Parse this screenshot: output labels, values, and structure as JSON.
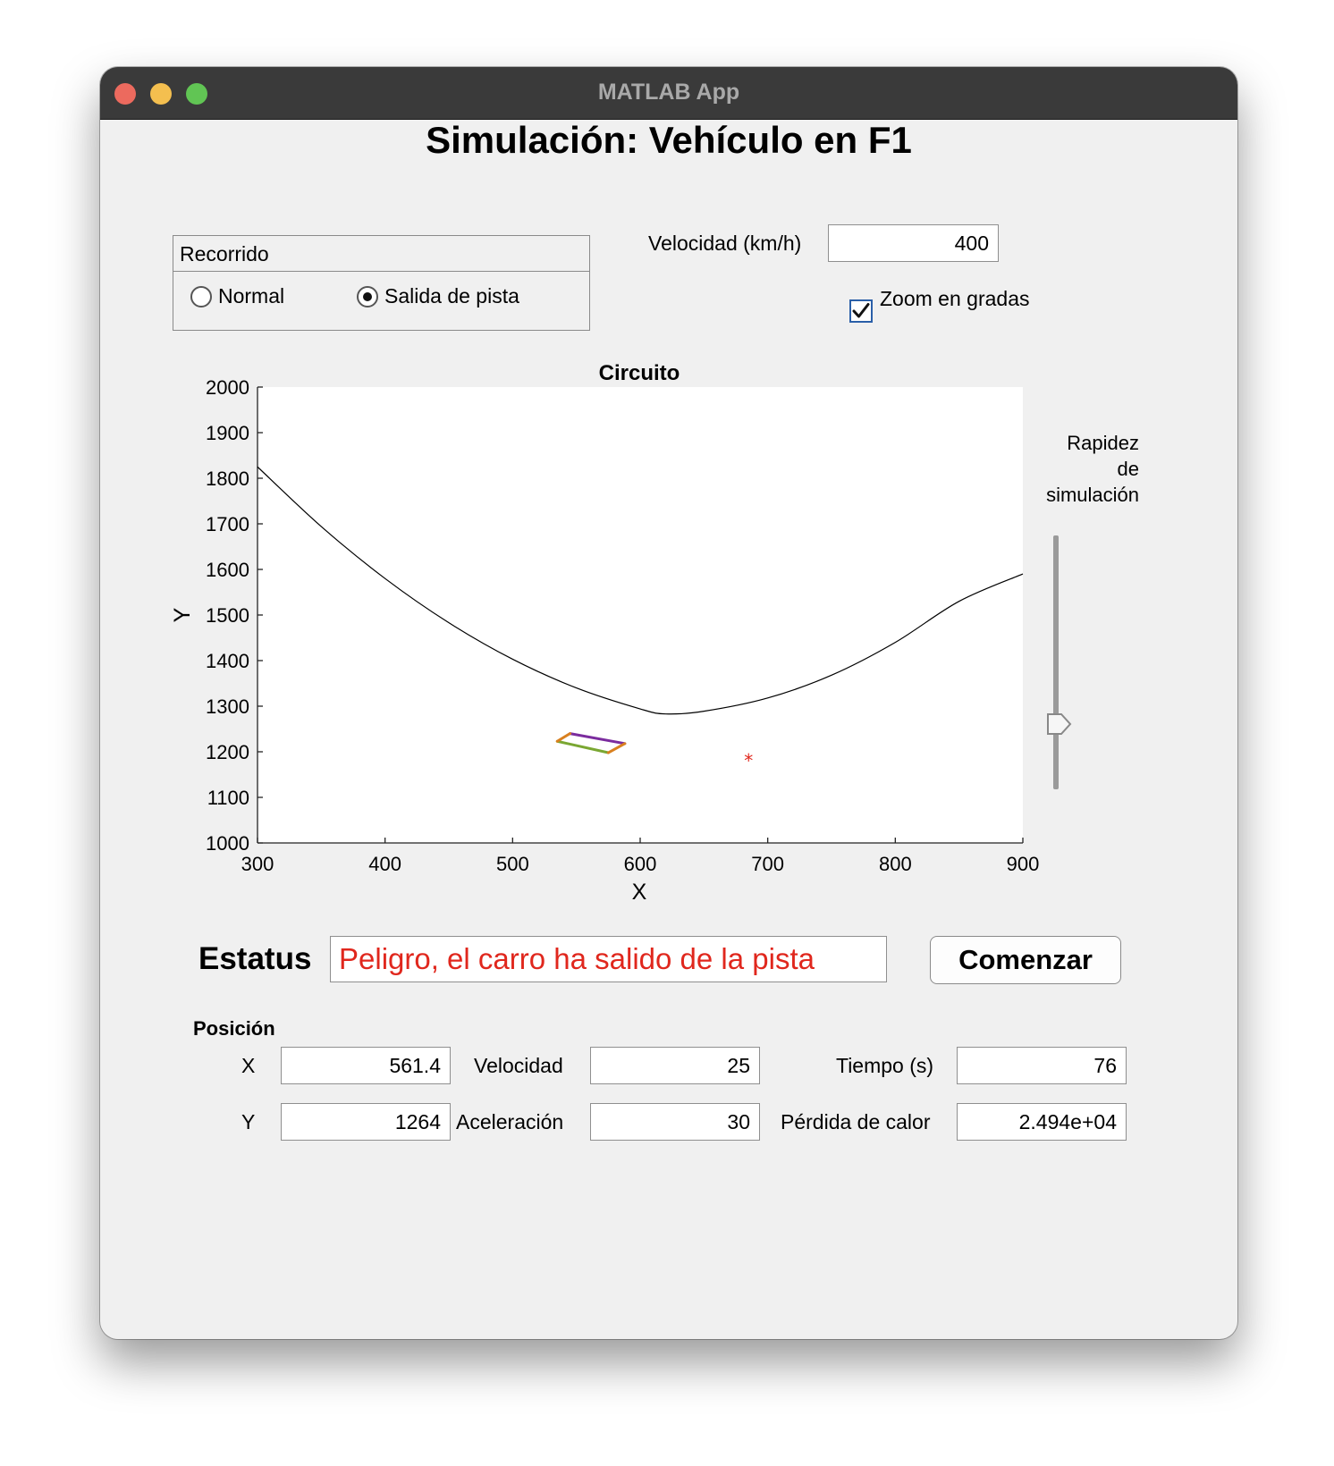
{
  "window": {
    "title": "MATLAB App"
  },
  "app": {
    "title": "Simulación: Vehículo en F1"
  },
  "recorrido": {
    "title": "Recorrido",
    "options": [
      {
        "label": "Normal",
        "selected": false
      },
      {
        "label": "Salida de pista",
        "selected": true
      }
    ]
  },
  "velocidad_input": {
    "label": "Velocidad (km/h)",
    "value": "400"
  },
  "zoom_checkbox": {
    "label": "Zoom en gradas",
    "checked": true
  },
  "slider": {
    "label_lines": [
      "Rapidez",
      "de",
      "simulación"
    ],
    "value_fraction": 0.25
  },
  "status": {
    "label": "Estatus",
    "value": "Peligro, el carro ha salido de la pista",
    "color": "#e0271d"
  },
  "start_button": {
    "label": "Comenzar"
  },
  "readouts": {
    "position_title": "Posición",
    "x_label": "X",
    "x_value": "561.4",
    "y_label": "Y",
    "y_value": "1264",
    "speed_label": "Velocidad",
    "speed_value": "25",
    "accel_label": "Aceleración",
    "accel_value": "30",
    "time_label": "Tiempo (s)",
    "time_value": "76",
    "heat_label": "Pérdida de calor",
    "heat_value": "2.494e+04"
  },
  "chart_data": {
    "type": "line",
    "title": "Circuito",
    "xlabel": "X",
    "ylabel": "Y",
    "xlim": [
      300,
      900
    ],
    "ylim": [
      1000,
      2000
    ],
    "xticks": [
      "300",
      "400",
      "500",
      "600",
      "700",
      "800",
      "900"
    ],
    "yticks": [
      "1000",
      "1100",
      "1200",
      "1300",
      "1400",
      "1500",
      "1600",
      "1700",
      "1800",
      "1900",
      "2000"
    ],
    "grid": false,
    "series": [
      {
        "kind": "track",
        "color": "#000000",
        "x": [
          300,
          350,
          400,
          450,
          500,
          550,
          600,
          620,
          650,
          700,
          750,
          800,
          850,
          900
        ],
        "y": [
          1825,
          1694,
          1580,
          1483,
          1403,
          1340,
          1294,
          1283,
          1289,
          1318,
          1368,
          1440,
          1530,
          1590
        ]
      },
      {
        "kind": "car",
        "edges": [
          {
            "color": "#7b2c9e",
            "x": [
              545,
              588
            ],
            "y": [
              1240,
              1218
            ]
          },
          {
            "color": "#7aa732",
            "x": [
              535,
              575
            ],
            "y": [
              1223,
              1198
            ]
          },
          {
            "color": "#d9801f",
            "x": [
              535,
              545
            ],
            "y": [
              1223,
              1240
            ]
          },
          {
            "color": "#d9801f",
            "x": [
              575,
              588
            ],
            "y": [
              1198,
              1218
            ]
          }
        ]
      },
      {
        "kind": "marker",
        "color": "#e0271d",
        "symbol": "*",
        "x": [
          685
        ],
        "y": [
          1188
        ]
      }
    ]
  },
  "colors": {
    "window_bg": "#f0f0f0",
    "titlebar": "#3a3a3a",
    "status_text": "#e0271d",
    "checkbox_border": "#2a5fa8"
  }
}
